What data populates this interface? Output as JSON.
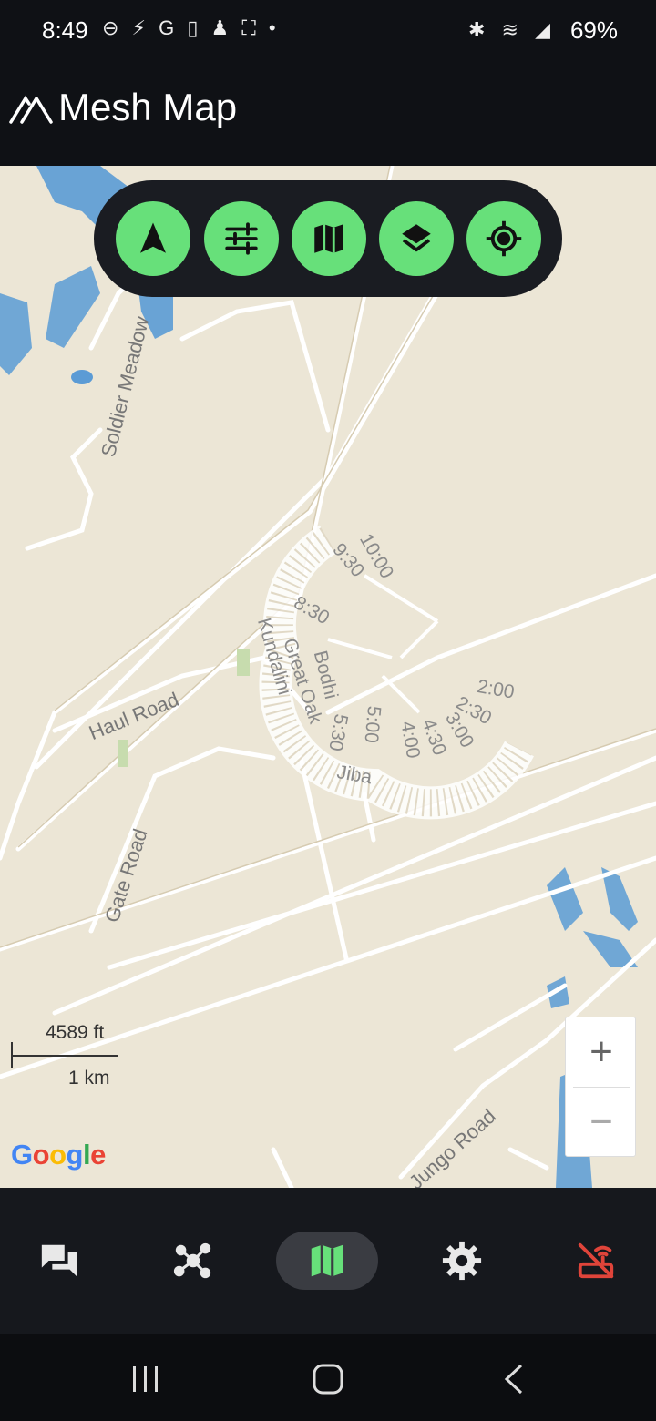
{
  "status_bar": {
    "time": "8:49",
    "left_icons": "⊖ ⚡ G ▯ ♟ ⛶ •",
    "right_icons": "✱ ≋ ◢",
    "battery": "69%"
  },
  "app_bar": {
    "title": "Mesh Map"
  },
  "map": {
    "scale_imperial": "4589 ft",
    "scale_metric": "1 km",
    "attribution": [
      "G",
      "o",
      "o",
      "g",
      "l",
      "e"
    ],
    "attribution_colors": [
      "#4285F4",
      "#EA4335",
      "#FBBC05",
      "#4285F4",
      "#34A853",
      "#EA4335"
    ],
    "road_labels": {
      "soldier": "Soldier Meadow",
      "haul": "Haul Road",
      "gate": "Gate Road",
      "jungo": "Jungo Road",
      "kundalini": "Kundalini",
      "great_oak": "Great Oak",
      "bodhi": "Bodhi",
      "jiba": "Jiba"
    },
    "clock_labels": {
      "t1000": "10:00",
      "t930": "9:30",
      "t830": "8:30",
      "t200": "2:00",
      "t230": "2:30",
      "t300": "3:00",
      "t430": "4:30",
      "t400": "4:00",
      "t500": "5:00",
      "t530": "5:30"
    },
    "zoom_in": "+",
    "zoom_out": "−"
  },
  "toolbar": {
    "buttons": [
      "navigation-icon",
      "tune-icon",
      "map-icon",
      "layers-icon",
      "my-location-icon"
    ]
  },
  "bottom_nav": {
    "items": [
      "messages-icon",
      "nodes-icon",
      "map-icon",
      "settings-icon",
      "disconnected-router-icon"
    ],
    "active": "map-icon",
    "disconnected_color": "#e0443a"
  },
  "colors": {
    "accent": "#67e07a",
    "map_bg": "#ece6d6",
    "water": "#5b9bd5"
  }
}
